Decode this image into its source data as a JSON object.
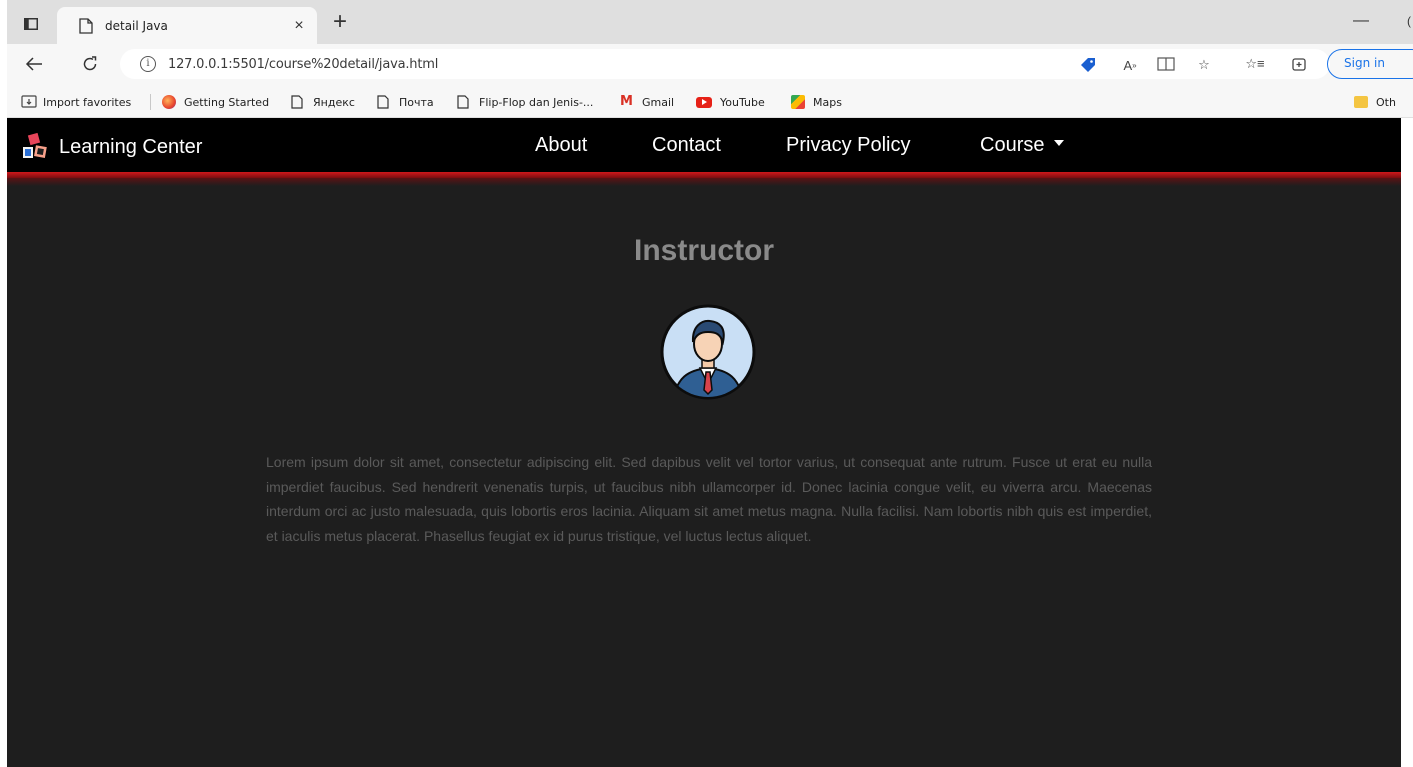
{
  "browser": {
    "tab_title": "detail Java",
    "new_tab_label": "+",
    "close_tab_label": "×",
    "minimize_label": "—",
    "url": "127.0.0.1:5501/course%20detail/java.html",
    "signin_label": "Sign in",
    "favorites": [
      {
        "label": "Import favorites",
        "icon": "import-icon"
      },
      {
        "label": "Getting Started",
        "icon": "firefox-icon"
      },
      {
        "label": "Яндекс",
        "icon": "page-icon"
      },
      {
        "label": "Почта",
        "icon": "page-icon"
      },
      {
        "label": "Flip-Flop dan Jenis-...",
        "icon": "page-icon"
      },
      {
        "label": "Gmail",
        "icon": "gmail-icon"
      },
      {
        "label": "YouTube",
        "icon": "youtube-icon"
      },
      {
        "label": "Maps",
        "icon": "maps-icon"
      },
      {
        "label": "Oth",
        "icon": "folder-icon"
      }
    ]
  },
  "site": {
    "brand": "Learning Center",
    "nav": {
      "about": "About",
      "contact": "Contact",
      "privacy": "Privacy Policy",
      "course": "Course"
    },
    "heading": "Instructor",
    "description": "Lorem ipsum dolor sit amet, consectetur adipiscing elit. Sed dapibus velit vel tortor varius, ut consequat ante rutrum. Fusce ut erat eu nulla imperdiet faucibus. Sed hendrerit venenatis turpis, ut faucibus nibh ullamcorper id. Donec lacinia congue velit, eu viverra arcu. Maecenas interdum orci ac justo malesuada, quis lobortis eros lacinia. Aliquam sit amet metus magna. Nulla facilisi. Nam lobortis nibh quis est imperdiet, et iaculis metus placerat. Phasellus feugiat ex id purus tristique, vel luctus lectus aliquet."
  },
  "colors": {
    "navbar_bg": "#000000",
    "page_bg": "#1e1e1e",
    "accent_red": "#d0181b",
    "heading_text": "#8a8a8a",
    "body_text": "#5a5a5a"
  }
}
